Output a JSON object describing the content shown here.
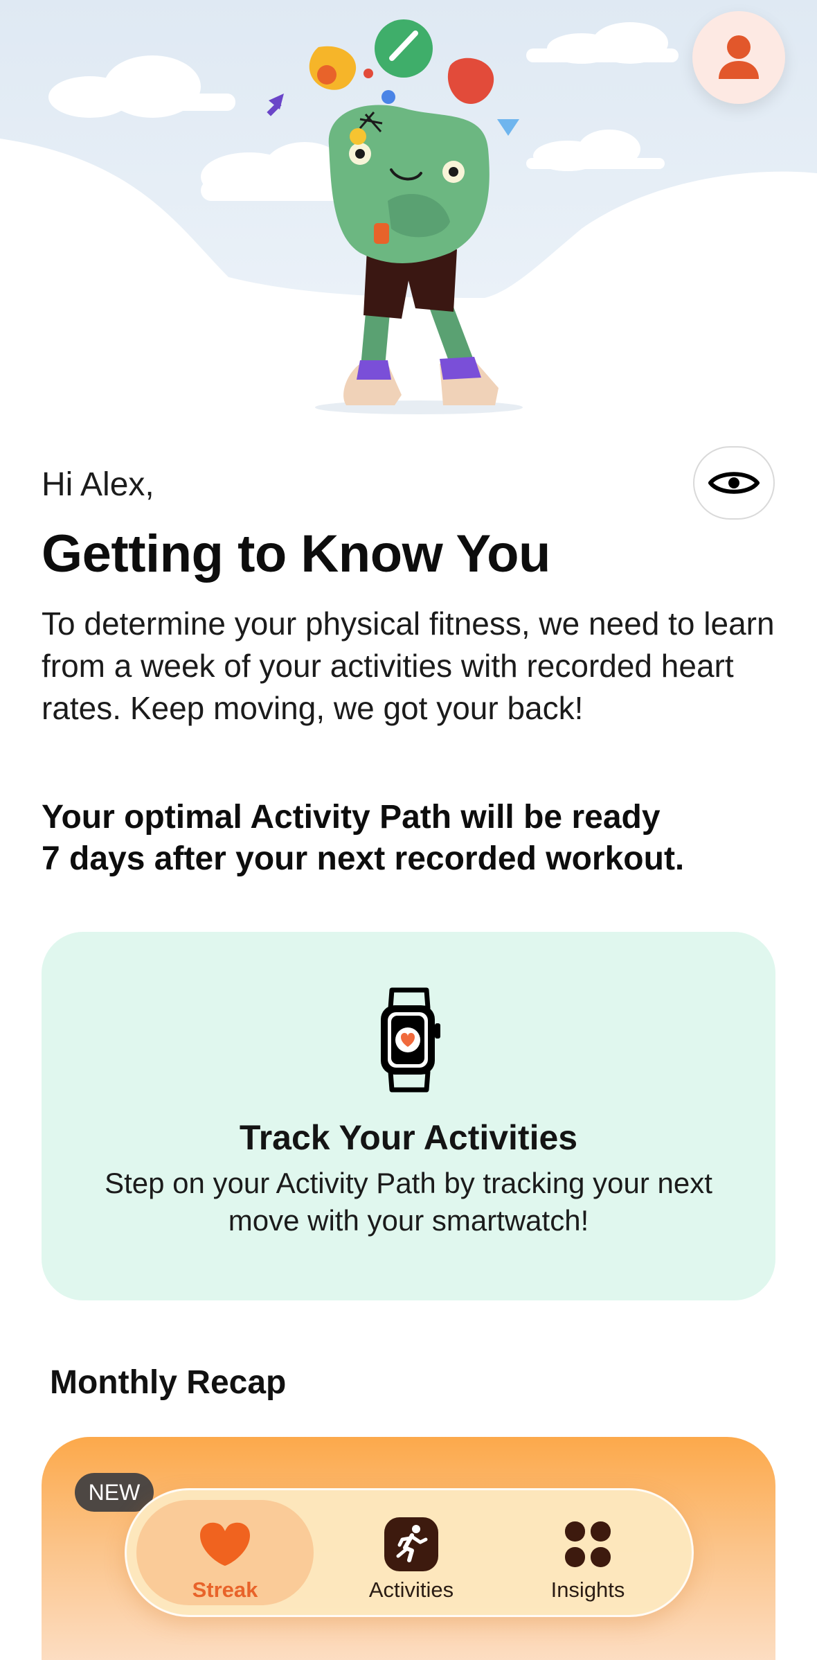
{
  "greeting": "Hi Alex,",
  "title": "Getting to Know You",
  "intro": "To determine your physical fitness, we need to learn from a week of your activities with recorded heart rates. Keep moving, we got your back!",
  "highlight_line1": "Your optimal Activity Path will be ready",
  "highlight_line2": "7 days after your next recorded workout.",
  "track_card": {
    "title": "Track Your Activities",
    "description": "Step on your Activity Path by tracking your next move with your smartwatch!"
  },
  "recap": {
    "title": "Monthly Recap",
    "badge": "NEW"
  },
  "tabs": [
    {
      "label": "Streak",
      "icon": "heart-icon",
      "active": true
    },
    {
      "label": "Activities",
      "icon": "runner-icon",
      "active": false
    },
    {
      "label": "Insights",
      "icon": "grid-icon",
      "active": false
    }
  ],
  "colors": {
    "accent": "#e8632a",
    "card_mint": "#e0f7ee",
    "recap_orange": "#fca94b",
    "tabbar_bg": "#fde8be"
  }
}
